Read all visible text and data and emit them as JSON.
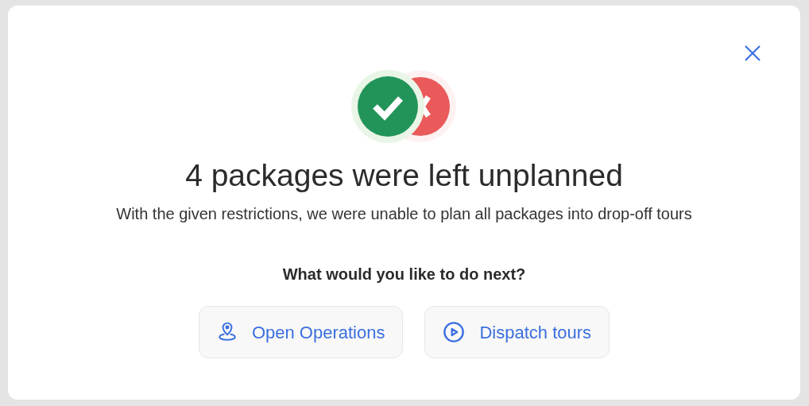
{
  "dialog": {
    "title": "4 packages were left unplanned",
    "message": "With the given restrictions, we were unable to plan all packages into drop-off tours",
    "question": "What would you like to do next?",
    "actions": [
      {
        "label": "Open Operations",
        "kind": "location"
      },
      {
        "label": "Dispatch tours",
        "kind": "play"
      }
    ]
  }
}
